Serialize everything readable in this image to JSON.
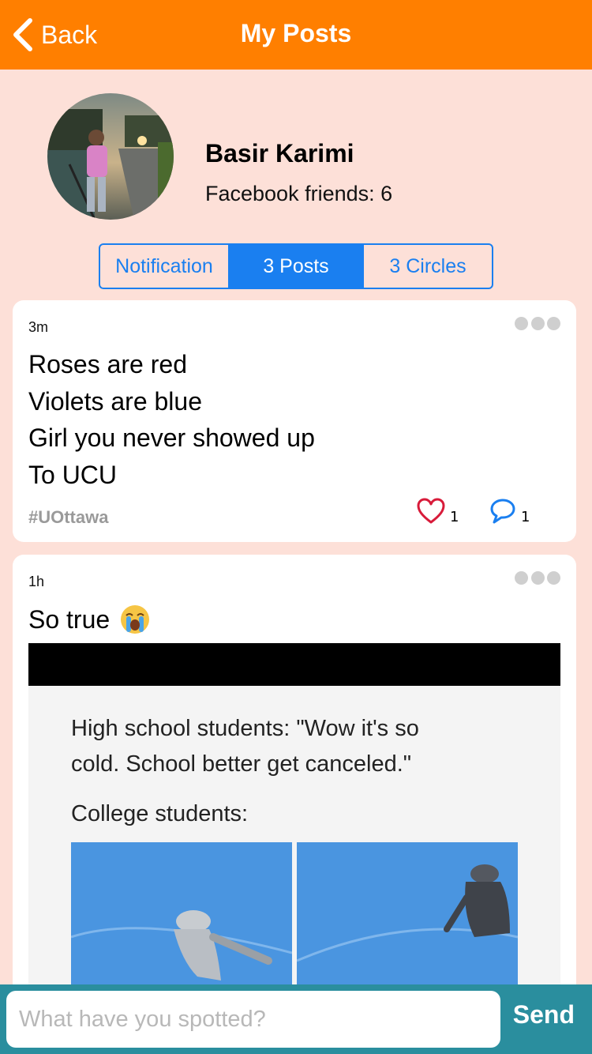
{
  "nav": {
    "back_label": "Back",
    "title": "My Posts"
  },
  "profile": {
    "name": "Basir Karimi",
    "friends": "Facebook friends: 6"
  },
  "tabs": [
    {
      "label": "Notification",
      "selected": false
    },
    {
      "label": "3 Posts",
      "selected": true
    },
    {
      "label": "3 Circles",
      "selected": false
    }
  ],
  "posts": [
    {
      "time": "3m",
      "lines": [
        "Roses are red",
        "Violets are blue",
        "Girl you never showed up",
        "To UCU"
      ],
      "hashtag": "#UOttawa",
      "likes": "1",
      "comments": "1"
    },
    {
      "time": "1h",
      "title": "So true",
      "emoji": "loudly-crying-face",
      "meme_text": [
        "High school students: \"Wow it's so",
        "cold. School better get canceled.\"",
        "College students:"
      ]
    }
  ],
  "composer": {
    "placeholder": "What have you spotted?",
    "send_label": "Send"
  },
  "colors": {
    "nav": "#ff7f00",
    "background": "#fde0d8",
    "accent": "#1a7ff0",
    "bottom_bar": "#2a8e9e"
  }
}
